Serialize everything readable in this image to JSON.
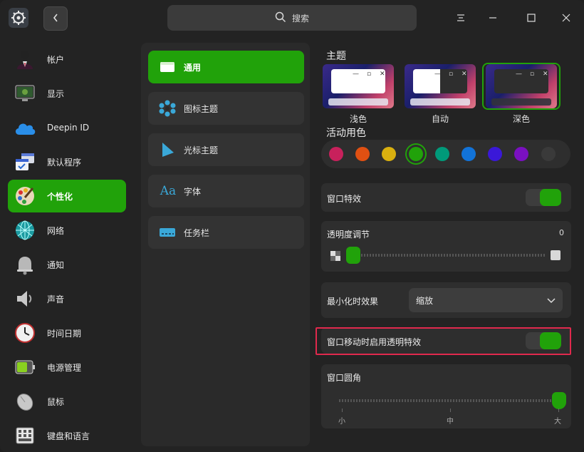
{
  "search": {
    "label": "搜索"
  },
  "sidebar": {
    "items": [
      {
        "label": "帐户",
        "icon": "user-avatar-icon"
      },
      {
        "label": "显示",
        "icon": "monitor-icon"
      },
      {
        "label": "Deepin ID",
        "icon": "cloud-icon"
      },
      {
        "label": "默认程序",
        "icon": "default-apps-icon"
      },
      {
        "label": "个性化",
        "icon": "palette-icon",
        "active": true
      },
      {
        "label": "网络",
        "icon": "network-globe-icon"
      },
      {
        "label": "通知",
        "icon": "bell-icon"
      },
      {
        "label": "声音",
        "icon": "speaker-icon"
      },
      {
        "label": "时间日期",
        "icon": "clock-icon"
      },
      {
        "label": "电源管理",
        "icon": "battery-icon"
      },
      {
        "label": "鼠标",
        "icon": "mouse-icon"
      },
      {
        "label": "键盘和语言",
        "icon": "keyboard-icon"
      }
    ]
  },
  "subnav": {
    "items": [
      {
        "label": "通用",
        "icon": "window-general-icon",
        "active": true
      },
      {
        "label": "图标主题",
        "icon": "icon-theme-icon"
      },
      {
        "label": "光标主题",
        "icon": "cursor-theme-icon"
      },
      {
        "label": "字体",
        "icon": "font-icon"
      },
      {
        "label": "任务栏",
        "icon": "taskbar-icon"
      }
    ]
  },
  "theme": {
    "title": "主题",
    "options": [
      {
        "label": "浅色"
      },
      {
        "label": "自动"
      },
      {
        "label": "深色",
        "selected": true
      }
    ]
  },
  "accent": {
    "title": "活动用色",
    "colors": [
      "#c8215c",
      "#e05012",
      "#d9b00f",
      "#21a20a",
      "#009a7a",
      "#1273d8",
      "#3a18d8",
      "#7a10c0",
      "#3a3a3a"
    ],
    "selected_index": 3
  },
  "window_effect": {
    "label": "窗口特效",
    "on": true
  },
  "transparency": {
    "label": "透明度调节",
    "value": "0"
  },
  "minimize": {
    "label": "最小化时效果",
    "value": "缩放"
  },
  "move_transparent": {
    "label": "窗口移动时启用透明特效",
    "on": true
  },
  "corner": {
    "label": "窗口圆角",
    "ticks": [
      "小",
      "中",
      "大"
    ],
    "value": "大"
  },
  "colors": {
    "accent": "#21a20a",
    "highlight": "#e0294d"
  }
}
